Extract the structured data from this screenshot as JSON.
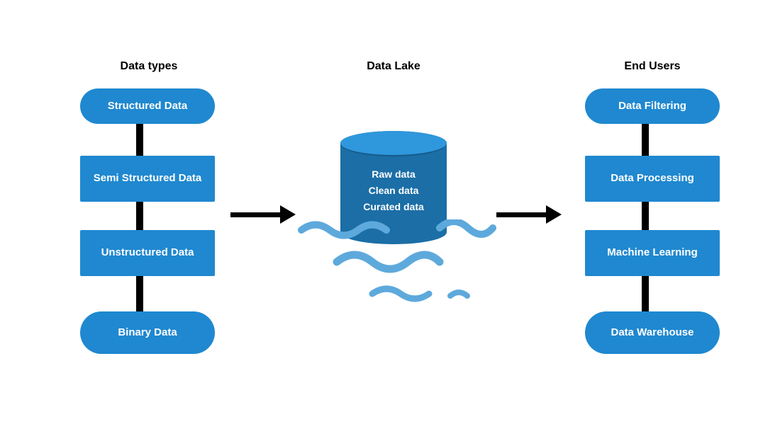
{
  "colors": {
    "node_fill": "#1f88d0",
    "cylinder_top": "#2f97dc",
    "cylinder_body": "#1b6ea6",
    "wave": "#5ea9dc",
    "connector": "#000000"
  },
  "columns": {
    "data_types": {
      "heading": "Data types",
      "items": [
        {
          "id": "structured",
          "label": "Structured Data",
          "shape": "pill"
        },
        {
          "id": "semi_structured",
          "label": "Semi Structured Data",
          "shape": "rect"
        },
        {
          "id": "unstructured",
          "label": "Unstructured Data",
          "shape": "rect"
        },
        {
          "id": "binary",
          "label": "Binary Data",
          "shape": "pill"
        }
      ]
    },
    "data_lake": {
      "heading": "Data Lake",
      "cylinder_lines": [
        "Raw data",
        "Clean data",
        "Curated data"
      ]
    },
    "end_users": {
      "heading": "End Users",
      "items": [
        {
          "id": "filtering",
          "label": "Data Filtering",
          "shape": "pill"
        },
        {
          "id": "processing",
          "label": "Data Processing",
          "shape": "rect"
        },
        {
          "id": "ml",
          "label": "Machine Learning",
          "shape": "rect"
        },
        {
          "id": "warehouse",
          "label": "Data Warehouse",
          "shape": "pill"
        }
      ]
    }
  },
  "flows": [
    {
      "from": "data_types",
      "to": "data_lake"
    },
    {
      "from": "data_lake",
      "to": "end_users"
    }
  ]
}
